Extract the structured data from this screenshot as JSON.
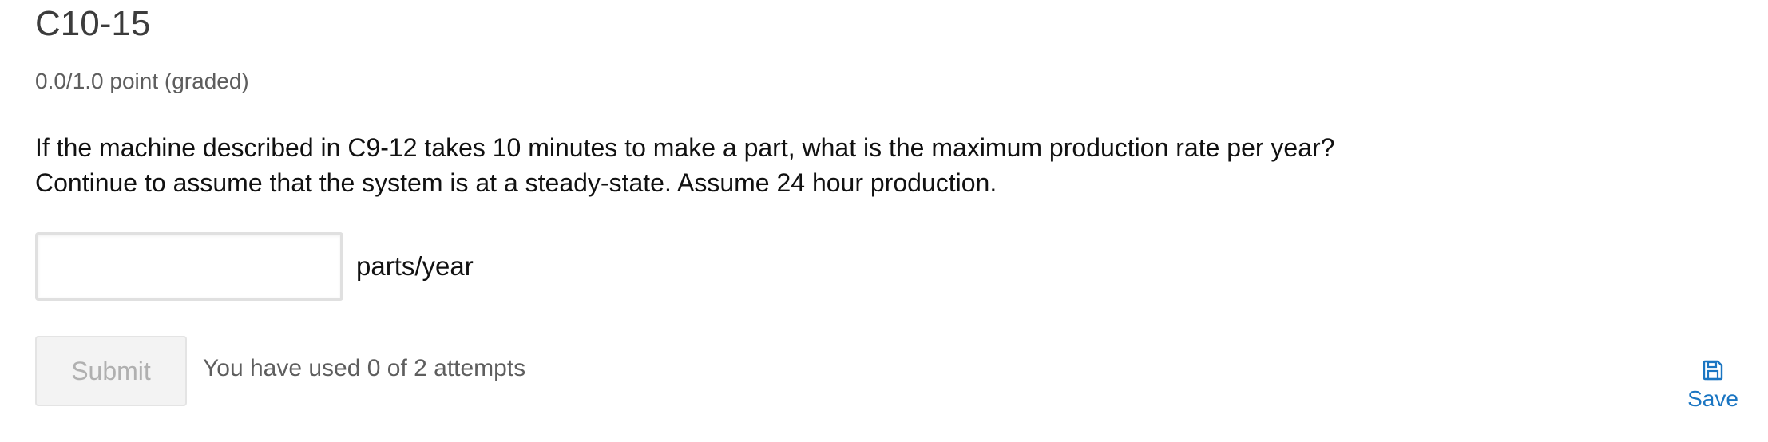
{
  "problem": {
    "title": "C10-15",
    "points": "0.0/1.0 point (graded)",
    "question_line1": "If the machine described in C9-12 takes 10 minutes to make a part, what is the maximum production rate per year?",
    "question_line2": "Continue to assume that the system is at a steady-state. Assume 24 hour production."
  },
  "answer": {
    "value": "",
    "placeholder": "",
    "unit": "parts/year"
  },
  "actions": {
    "submit_label": "Submit",
    "attempts_text": "You have used 0 of 2 attempts",
    "save_label": "Save",
    "save_icon": "floppy-disk-icon"
  },
  "colors": {
    "link_blue": "#1a75c2",
    "disabled_text": "#b0b0b0"
  }
}
